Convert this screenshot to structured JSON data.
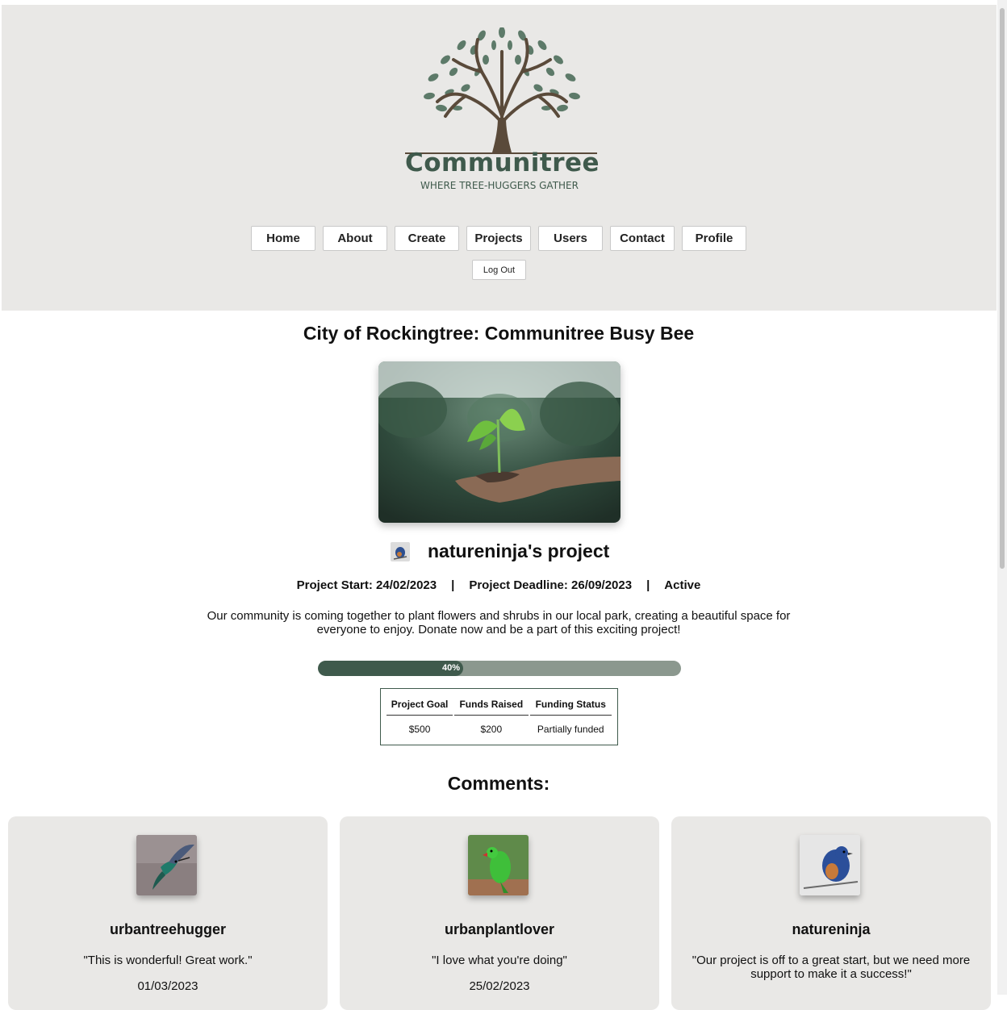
{
  "brand": {
    "name": "Communitree",
    "tagline": "WHERE TREE-HUGGERS GATHER",
    "colors": {
      "primary": "#3f5a4c",
      "header_bg": "#e9e8e6",
      "progress_track": "#8b988e"
    }
  },
  "nav": {
    "items": [
      {
        "label": "Home"
      },
      {
        "label": "About"
      },
      {
        "label": "Create"
      },
      {
        "label": "Projects"
      },
      {
        "label": "Users"
      },
      {
        "label": "Contact"
      },
      {
        "label": "Profile"
      }
    ],
    "logout_label": "Log Out"
  },
  "project": {
    "title": "City of Rockingtree: Communitree Busy Bee",
    "owner_heading": "natureninja's project",
    "start": "Project Start: 24/02/2023",
    "deadline": "Project Deadline: 26/09/2023",
    "status": "Active",
    "separator": "|",
    "description": "Our community is coming together to plant flowers and shrubs in our local park, creating a beautiful space for everyone to enjoy. Donate now and be a part of this exciting project!",
    "progress": {
      "percent": 40,
      "label": "40%"
    },
    "funding_table": {
      "headers": [
        "Project Goal",
        "Funds Raised",
        "Funding Status"
      ],
      "row": [
        "$500",
        "$200",
        "Partially funded"
      ]
    }
  },
  "comments": {
    "heading": "Comments:",
    "items": [
      {
        "username": "urbantreehugger",
        "text": "\"This is wonderful! Great work.\"",
        "date": "01/03/2023",
        "avatar_icon": "hummingbird-avatar"
      },
      {
        "username": "urbanplantlover",
        "text": "\"I love what you're doing\"",
        "date": "25/02/2023",
        "avatar_icon": "green-parrot-avatar"
      },
      {
        "username": "natureninja",
        "text": "\"Our project is off to a great start, but we need more support to make it a success!\"",
        "date": "",
        "avatar_icon": "bluebird-avatar"
      }
    ]
  }
}
